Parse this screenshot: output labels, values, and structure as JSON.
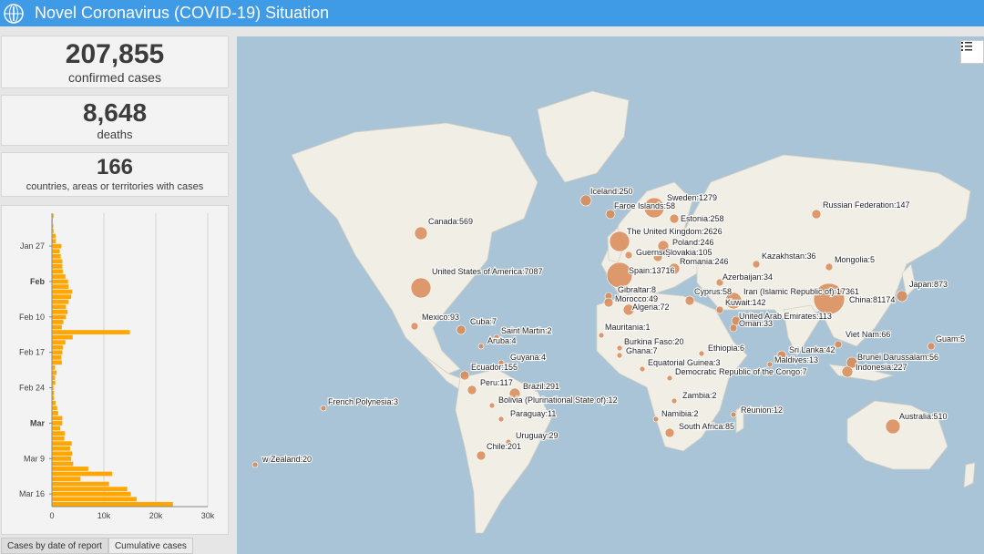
{
  "header": {
    "title": "Novel Coronavirus (COVID-19) Situation",
    "logo_icon": "who-emblem-icon"
  },
  "stats": [
    {
      "value": "207,855",
      "label": "confirmed cases"
    },
    {
      "value": "8,648",
      "label": "deaths"
    },
    {
      "value": "166",
      "label": "countries, areas or territories with cases"
    }
  ],
  "chart_data": {
    "type": "bar",
    "orientation": "horizontal",
    "title": "",
    "xlabel": "",
    "ylabel": "",
    "xlim": [
      0,
      30000
    ],
    "x_ticks": [
      "0",
      "10k",
      "20k",
      "30k"
    ],
    "y_tick_labels": [
      "Jan 27",
      "Feb",
      "Feb 10",
      "Feb 17",
      "Feb 24",
      "Mar",
      "Mar 9",
      "Mar 16"
    ],
    "y_tick_bold": [
      false,
      true,
      false,
      false,
      false,
      true,
      false,
      false
    ],
    "categories": [
      "Jan 21",
      "Jan 22",
      "Jan 23",
      "Jan 24",
      "Jan 25",
      "Jan 26",
      "Jan 27",
      "Jan 28",
      "Jan 29",
      "Jan 30",
      "Jan 31",
      "Feb 1",
      "Feb 2",
      "Feb 3",
      "Feb 4",
      "Feb 5",
      "Feb 6",
      "Feb 7",
      "Feb 8",
      "Feb 9",
      "Feb 10",
      "Feb 11",
      "Feb 12",
      "Feb 13",
      "Feb 14",
      "Feb 15",
      "Feb 16",
      "Feb 17",
      "Feb 18",
      "Feb 19",
      "Feb 20",
      "Feb 21",
      "Feb 22",
      "Feb 23",
      "Feb 24",
      "Feb 25",
      "Feb 26",
      "Feb 27",
      "Feb 28",
      "Feb 29",
      "Mar 1",
      "Mar 2",
      "Mar 3",
      "Mar 4",
      "Mar 5",
      "Mar 6",
      "Mar 7",
      "Mar 8",
      "Mar 9",
      "Mar 10",
      "Mar 11",
      "Mar 12",
      "Mar 13",
      "Mar 14",
      "Mar 15",
      "Mar 16",
      "Mar 17",
      "Mar 18"
    ],
    "values": [
      300,
      150,
      250,
      300,
      700,
      750,
      1800,
      1500,
      1700,
      2000,
      2000,
      2100,
      2600,
      3100,
      3200,
      3900,
      3700,
      3200,
      2700,
      3000,
      2700,
      2200,
      1900,
      15000,
      4000,
      2600,
      2100,
      2000,
      1800,
      1900,
      600,
      900,
      600,
      650,
      300,
      400,
      400,
      700,
      1000,
      1200,
      2000,
      2000,
      1600,
      2500,
      2400,
      3800,
      3500,
      3900,
      3700,
      4100,
      7000,
      11600,
      5500,
      11000,
      14500,
      15200,
      16300,
      23300
    ],
    "bar_color": "#ffa600",
    "grid": true
  },
  "tabs": [
    {
      "label": "Cases by date of report",
      "active": true
    },
    {
      "label": "Cumulative cases",
      "active": false
    }
  ],
  "map": {
    "legend_icon": "list-icon",
    "bubble_color": "#d98a55",
    "labels": [
      {
        "text": "Iceland:250"
      },
      {
        "text": "Sweden:1279"
      },
      {
        "text": "Faroe Islands:58"
      },
      {
        "text": "Russian Federation:147"
      },
      {
        "text": "Estonia:258"
      },
      {
        "text": "Canada:569"
      },
      {
        "text": "The United Kingdom:2626"
      },
      {
        "text": "Poland:246"
      },
      {
        "text": "Guernsey:1"
      },
      {
        "text": "Slovakia:105"
      },
      {
        "text": "Kazakhstan:36"
      },
      {
        "text": "Mongolia:5"
      },
      {
        "text": "Romania:246"
      },
      {
        "text": "Spain:13716"
      },
      {
        "text": "United States of America:7087"
      },
      {
        "text": "Azerbaijan:34"
      },
      {
        "text": "China:81174"
      },
      {
        "text": "Gibraltar:8"
      },
      {
        "text": "Cyprus:58"
      },
      {
        "text": "Iran (Islamic Republic of):17361"
      },
      {
        "text": "Japan:873"
      },
      {
        "text": "Morocco:49"
      },
      {
        "text": "Kuwait:142"
      },
      {
        "text": "Algeria:72"
      },
      {
        "text": "United Arab Emirates:113"
      },
      {
        "text": "Mexico:93"
      },
      {
        "text": "Cuba:7"
      },
      {
        "text": "Oman:33"
      },
      {
        "text": "Mauritania:1"
      },
      {
        "text": "Saint Martin:2"
      },
      {
        "text": "Viet Nam:66"
      },
      {
        "text": "Guam:5"
      },
      {
        "text": "Aruba:4"
      },
      {
        "text": "Burkina Faso:20"
      },
      {
        "text": "Ghana:7"
      },
      {
        "text": "Ethiopia:6"
      },
      {
        "text": "Sri Lanka:42"
      },
      {
        "text": "Guyana:4"
      },
      {
        "text": "Brunei Darussalam:56"
      },
      {
        "text": "Maldives:13"
      },
      {
        "text": "Ecuador:155"
      },
      {
        "text": "Equatorial Guinea:3"
      },
      {
        "text": "Indonesia:227"
      },
      {
        "text": "Democratic Republic of the Congo:7"
      },
      {
        "text": "Peru:117"
      },
      {
        "text": "Brazil:291"
      },
      {
        "text": "Zambia:2"
      },
      {
        "text": "French Polynesia:3"
      },
      {
        "text": "Bolivia (Plurinational State of):12"
      },
      {
        "text": "Réunion:12"
      },
      {
        "text": "Paraguay:11"
      },
      {
        "text": "Namibia:2"
      },
      {
        "text": "Australia:510"
      },
      {
        "text": "South Africa:85"
      },
      {
        "text": "Uruguay:29"
      },
      {
        "text": "Chile:201"
      },
      {
        "text": "w Zealand:20"
      }
    ]
  }
}
